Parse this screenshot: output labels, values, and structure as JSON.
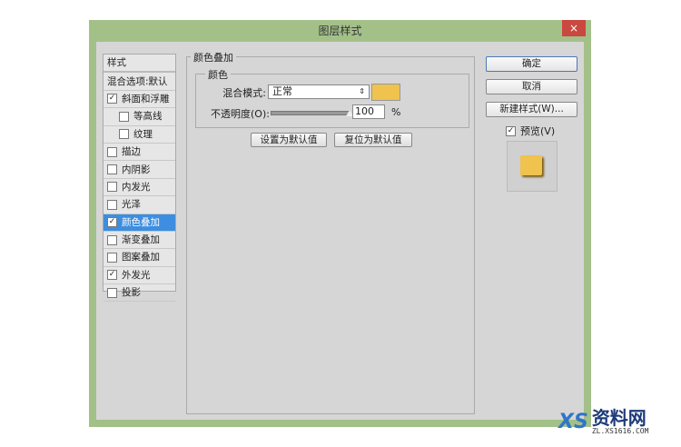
{
  "window": {
    "title": "图层样式",
    "close": "×"
  },
  "sidebar": {
    "header": "样式",
    "items": [
      {
        "label": "混合选项:默认",
        "checked": null
      },
      {
        "label": "斜面和浮雕",
        "checked": true
      },
      {
        "label": "等高线",
        "checked": false,
        "sub": true
      },
      {
        "label": "纹理",
        "checked": false,
        "sub": true
      },
      {
        "label": "描边",
        "checked": false
      },
      {
        "label": "内阴影",
        "checked": false
      },
      {
        "label": "内发光",
        "checked": false
      },
      {
        "label": "光泽",
        "checked": false
      },
      {
        "label": "颜色叠加",
        "checked": true,
        "selected": true
      },
      {
        "label": "渐变叠加",
        "checked": false
      },
      {
        "label": "图案叠加",
        "checked": false
      },
      {
        "label": "外发光",
        "checked": true
      },
      {
        "label": "投影",
        "checked": false
      }
    ]
  },
  "panel": {
    "title": "颜色叠加",
    "group": "颜色",
    "blend_label": "混合模式:",
    "blend_value": "正常",
    "color": "#f0c24e",
    "opacity_label": "不透明度(O):",
    "opacity_value": "100",
    "opacity_unit": "%",
    "opacity_percent": 100,
    "set_default": "设置为默认值",
    "reset_default": "复位为默认值"
  },
  "actions": {
    "ok": "确定",
    "cancel": "取消",
    "new_style": "新建样式(W)...",
    "preview": "预览(V)",
    "preview_checked": true
  },
  "watermark": {
    "text": "资料网",
    "url": "ZL.XS1616.COM"
  }
}
